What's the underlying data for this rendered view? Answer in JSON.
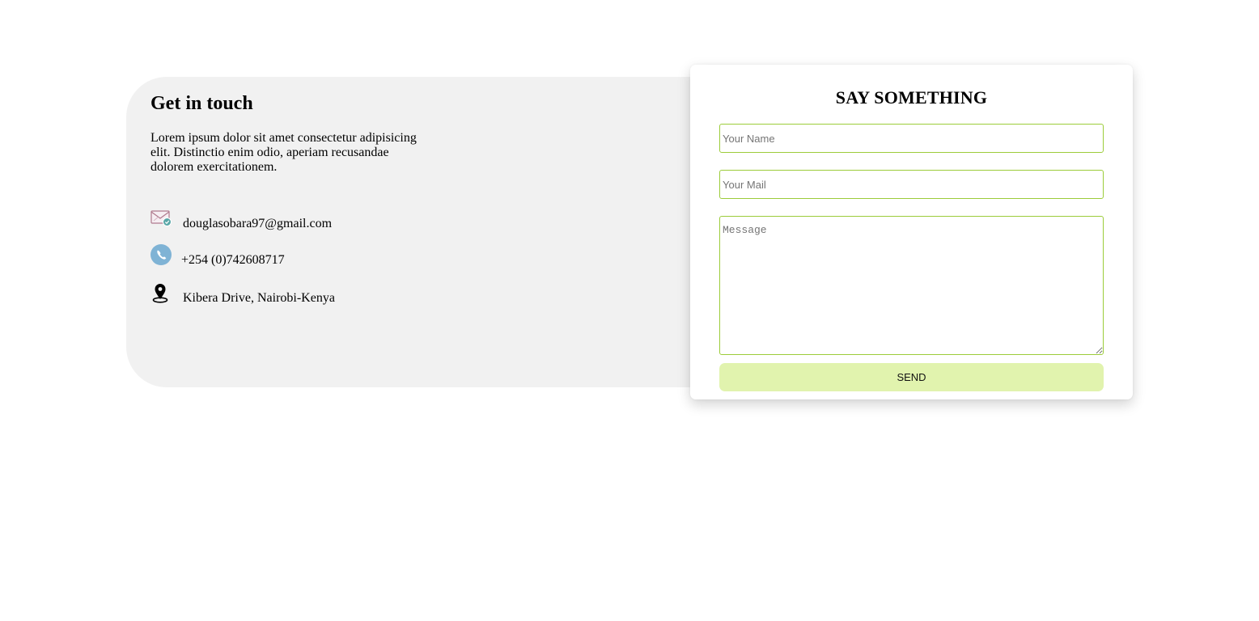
{
  "contact_info": {
    "title": "Get in touch",
    "description": "Lorem ipsum dolor sit amet consectetur adipisicing elit. Distinctio enim odio, aperiam recusandae dolorem exercitationem.",
    "email": {
      "icon": "mail-icon",
      "text": "douglasobara97@gmail.com"
    },
    "phone": {
      "icon": "phone-icon",
      "text": "+254 (0)742608717"
    },
    "address": {
      "icon": "location-pin-icon",
      "text": "Kibera Drive, Nairobi-Kenya"
    }
  },
  "form": {
    "title": "SAY SOMETHING",
    "name_placeholder": "Your Name",
    "mail_placeholder": "Your Mail",
    "message_placeholder": "Message",
    "send_label": "SEND"
  },
  "colors": {
    "panel_bg": "#f1f1f1",
    "input_border": "#9ccc3a",
    "button_bg": "#e1f3ae",
    "phone_icon": "#7fb3d5"
  }
}
